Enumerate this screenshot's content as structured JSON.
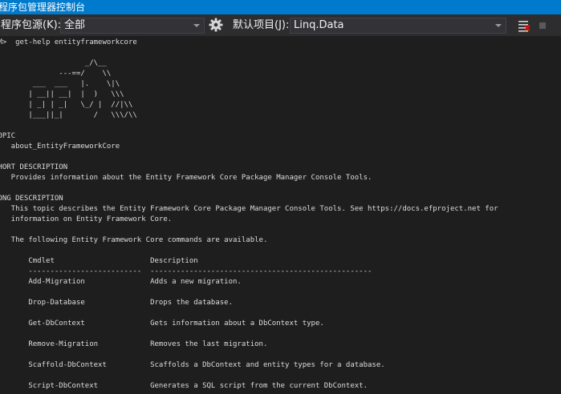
{
  "window": {
    "title": "程序包管理器控制台"
  },
  "toolbar": {
    "source_label": "程序包源(K):",
    "source_value": "全部",
    "project_label": "默认项目(J):",
    "project_value": "Linq.Data"
  },
  "console": {
    "lines": [
      "PM>  get-help entityframeworkcore",
      "",
      "                     _/\\__",
      "               ---==/    \\\\",
      "         ___  ___   |.    \\|\\",
      "        | __|| __|  |  )   \\\\\\",
      "        | _| | _|   \\_/ |  //|\\\\",
      "        |___||_|       /   \\\\\\/\\\\",
      "",
      "TOPIC",
      "    about_EntityFrameworkCore",
      "",
      "SHORT DESCRIPTION",
      "    Provides information about the Entity Framework Core Package Manager Console Tools.",
      "",
      "LONG DESCRIPTION",
      "    This topic describes the Entity Framework Core Package Manager Console Tools. See https://docs.efproject.net for",
      "    information on Entity Framework Core.",
      "",
      "    The following Entity Framework Core commands are available.",
      "",
      "        Cmdlet                      Description",
      "        --------------------------  ---------------------------------------------------",
      "        Add-Migration               Adds a new migration.",
      "",
      "        Drop-Database               Drops the database.",
      "",
      "        Get-DbContext               Gets information about a DbContext type.",
      "",
      "        Remove-Migration            Removes the last migration.",
      "",
      "        Scaffold-DbContext          Scaffolds a DbContext and entity types for a database.",
      "",
      "        Script-DbContext            Generates a SQL script from the current DbContext."
    ]
  }
}
